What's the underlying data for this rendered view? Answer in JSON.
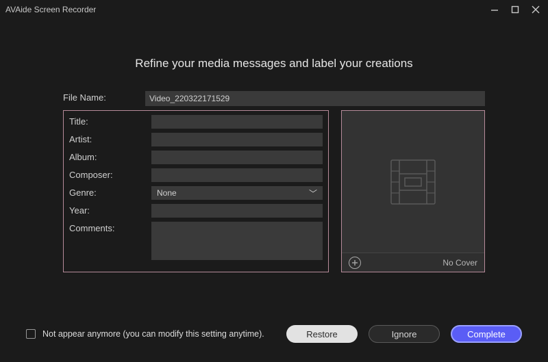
{
  "window": {
    "title": "AVAide Screen Recorder"
  },
  "heading": "Refine your media messages and label your creations",
  "fileName": {
    "label": "File Name:",
    "value": "Video_220322171529"
  },
  "fields": {
    "title": {
      "label": "Title:",
      "value": ""
    },
    "artist": {
      "label": "Artist:",
      "value": ""
    },
    "album": {
      "label": "Album:",
      "value": ""
    },
    "composer": {
      "label": "Composer:",
      "value": ""
    },
    "genre": {
      "label": "Genre:",
      "value": "None"
    },
    "year": {
      "label": "Year:",
      "value": ""
    },
    "comments": {
      "label": "Comments:",
      "value": ""
    }
  },
  "cover": {
    "noCoverLabel": "No Cover"
  },
  "footer": {
    "checkboxLabel": "Not appear anymore (you can modify this setting anytime).",
    "restore": "Restore",
    "ignore": "Ignore",
    "complete": "Complete"
  }
}
